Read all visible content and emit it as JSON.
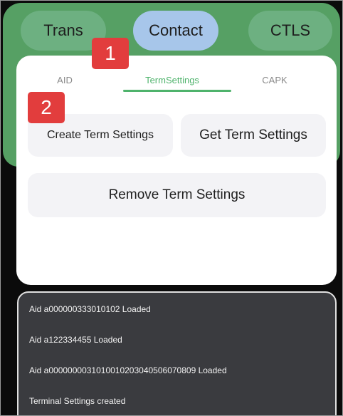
{
  "top_tabs": {
    "trans": "Trans",
    "contact": "Contact",
    "ctls": "CTLS"
  },
  "sub_tabs": {
    "aid": "AID",
    "term_settings": "TermSettings",
    "capk": "CAPK"
  },
  "actions": {
    "create": "Create Term Settings",
    "get": "Get Term Settings",
    "remove": "Remove Term Settings"
  },
  "annotations": {
    "badge_1": "1",
    "badge_2": "2"
  },
  "log": [
    "Aid a000000333010102 Loaded",
    "Aid a122334455 Loaded",
    "Aid a0000000031010010203040506070809 Loaded",
    "Terminal Settings created"
  ],
  "colors": {
    "accent_green": "#4fb36c",
    "band_green": "#56a064",
    "selected_tab": "#a7c6ea",
    "badge_red": "#e23d3d",
    "log_background": "#3a3b3f"
  }
}
